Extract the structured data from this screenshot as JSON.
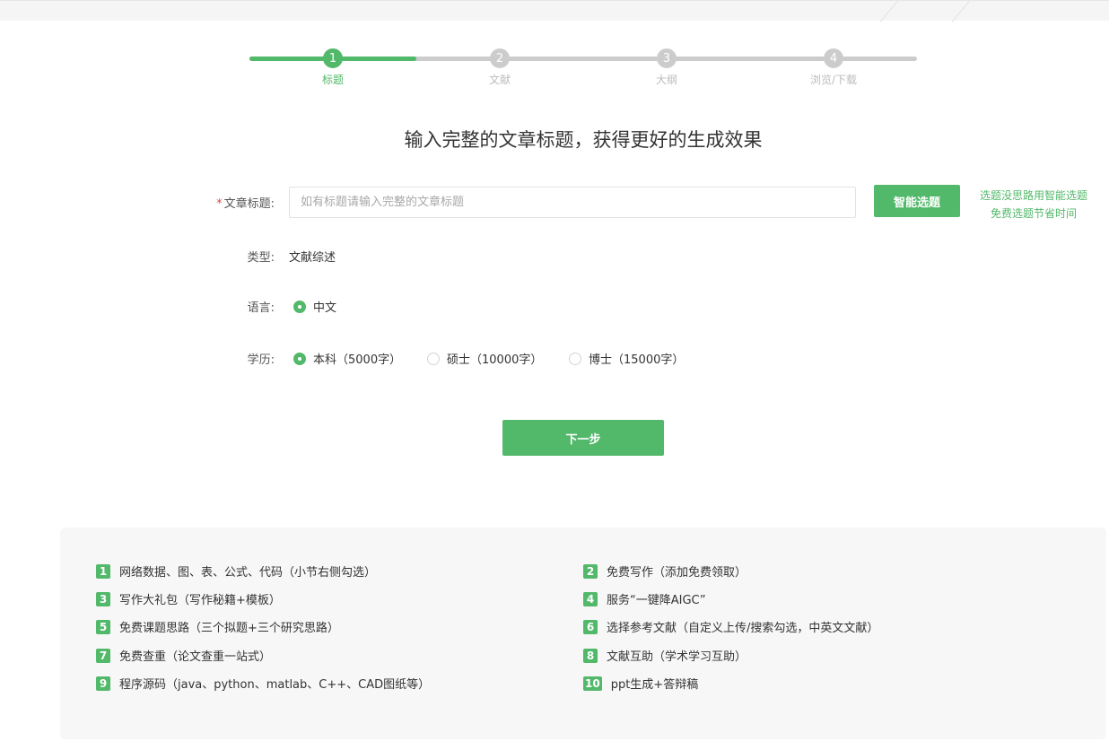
{
  "steps": [
    {
      "num": "1",
      "label": "标题"
    },
    {
      "num": "2",
      "label": "文献"
    },
    {
      "num": "3",
      "label": "大纲"
    },
    {
      "num": "4",
      "label": "浏览/下载"
    }
  ],
  "headline": "输入完整的文章标题，获得更好的生成效果",
  "form": {
    "required_mark": "*",
    "title_label": "文章标题:",
    "title_placeholder": "如有标题请输入完整的文章标题",
    "title_value": "",
    "smart_button": "智能选题",
    "tip_line1": "选题没思路用智能选题",
    "tip_line2": "免费选题节省时间",
    "type_label": "类型:",
    "type_value": "文献综述",
    "language_label": "语言:",
    "language_options": [
      "中文"
    ],
    "degree_label": "学历:",
    "degree_options": [
      "本科（5000字）",
      "硕士（10000字）",
      "博士（15000字）"
    ],
    "degree_selected": "本科（5000字）",
    "next_button": "下一步"
  },
  "features": [
    {
      "num": "1",
      "text": "网络数据、图、表、公式、代码（小节右侧勾选）"
    },
    {
      "num": "2",
      "text": "免费写作（添加免费领取）"
    },
    {
      "num": "3",
      "text": "写作大礼包（写作秘籍+模板）"
    },
    {
      "num": "4",
      "text": "服务“一键降AIGC”"
    },
    {
      "num": "5",
      "text": "免费课题思路（三个拟题+三个研究思路）"
    },
    {
      "num": "6",
      "text": "选择参考文献（自定义上传/搜索勾选，中英文文献）"
    },
    {
      "num": "7",
      "text": "免费查重（论文查重一站式）"
    },
    {
      "num": "8",
      "text": "文献互助（学术学习互助）"
    },
    {
      "num": "9",
      "text": "程序源码（java、python、matlab、C++、CAD图纸等）"
    },
    {
      "num": "10",
      "text": "ppt生成+答辩稿"
    }
  ],
  "colors": {
    "accent": "#52b86a",
    "inactive": "#cccccc"
  }
}
